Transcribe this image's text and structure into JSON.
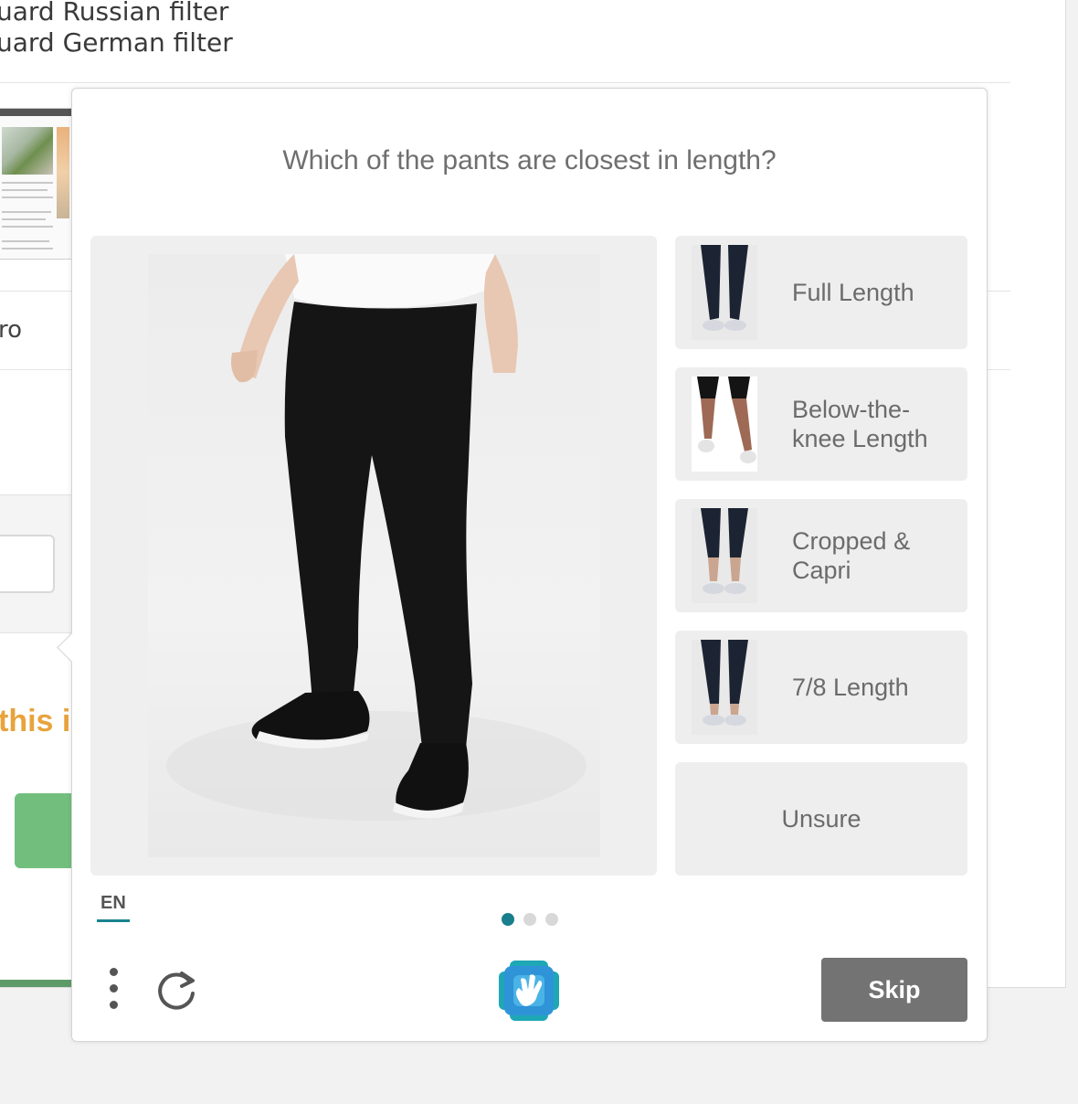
{
  "background": {
    "filters": [
      "uard Russian filter",
      "uard German filter"
    ],
    "partial_text": "ro",
    "orange_text": "this i"
  },
  "challenge": {
    "question": "Which of the pants are closest in length?",
    "options": [
      {
        "label": "Full Length",
        "icon": "full-length-pants-thumbnail"
      },
      {
        "label": "Below-the-knee Length",
        "icon": "below-knee-pants-thumbnail"
      },
      {
        "label": "Cropped & Capri",
        "icon": "cropped-capri-thumbnail"
      },
      {
        "label": "7/8 Length",
        "icon": "seven-eighths-thumbnail"
      },
      {
        "label": "Unsure"
      }
    ],
    "language": "EN",
    "pagination": {
      "total": 3,
      "current": 1
    },
    "skip_label": "Skip"
  },
  "colors": {
    "accent": "#1a7f8c",
    "skip_button": "#737373",
    "option_bg": "#eeeeee",
    "background_orange": "#e8a33c",
    "background_green": "#72bf7d"
  }
}
